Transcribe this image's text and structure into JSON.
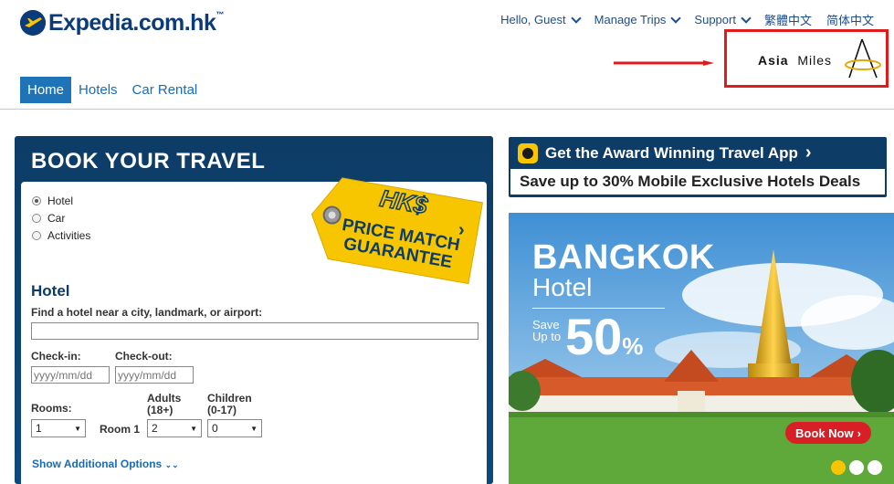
{
  "header": {
    "logo_text": "Expedia.com.hk",
    "logo_tm": "™",
    "nav": [
      {
        "label": "Hello, Guest",
        "has_dropdown": true
      },
      {
        "label": "Manage Trips",
        "has_dropdown": true
      },
      {
        "label": "Support",
        "has_dropdown": true
      },
      {
        "label": "繁體中文",
        "has_dropdown": false
      },
      {
        "label": "简体中文",
        "has_dropdown": false
      }
    ],
    "partner_logo": {
      "word1": "Asia",
      "word2": "Miles"
    }
  },
  "subnav": {
    "tabs": [
      {
        "label": "Home",
        "active": true
      },
      {
        "label": "Hotels",
        "active": false
      },
      {
        "label": "Car Rental",
        "active": false
      }
    ]
  },
  "booking": {
    "title": "BOOK YOUR TRAVEL",
    "options": [
      {
        "label": "Hotel",
        "selected": true
      },
      {
        "label": "Car",
        "selected": false
      },
      {
        "label": "Activities",
        "selected": false
      }
    ],
    "section_title": "Hotel",
    "destination_label": "Find a hotel near a city, landmark, or airport:",
    "destination_value": "",
    "checkin_label": "Check-in:",
    "checkin_placeholder": "yyyy/mm/dd",
    "checkout_label": "Check-out:",
    "checkout_placeholder": "yyyy/mm/dd",
    "rooms_label": "Rooms:",
    "rooms_value": "1",
    "room_label": "Room 1",
    "adults_label": "Adults",
    "adults_sub": "(18+)",
    "adults_value": "2",
    "children_label": "Children",
    "children_sub": "(0-17)",
    "children_value": "0",
    "more_options": "Show Additional Options",
    "price_tag": {
      "badge": "HK$",
      "line1": "PRICE MATCH",
      "line2": "GUARANTEE"
    }
  },
  "app_banner": {
    "title": "Get the Award Winning Travel App",
    "subtitle": "Save up to 30% Mobile Exclusive Hotels Deals"
  },
  "promo": {
    "city": "BANGKOK",
    "type": "Hotel",
    "save_line1": "Save",
    "save_line2": "Up to",
    "percent": "50",
    "percent_sign": "%",
    "cta": "Book Now",
    "carousel_count": 3,
    "carousel_active": 0
  },
  "colors": {
    "brand_blue": "#0b3b7a",
    "link_blue": "#1a6bb8",
    "panel_navy": "#0d3c66",
    "accent_yellow": "#f7c600",
    "highlight_red": "#e01b1b",
    "cta_red": "#d81f26"
  }
}
